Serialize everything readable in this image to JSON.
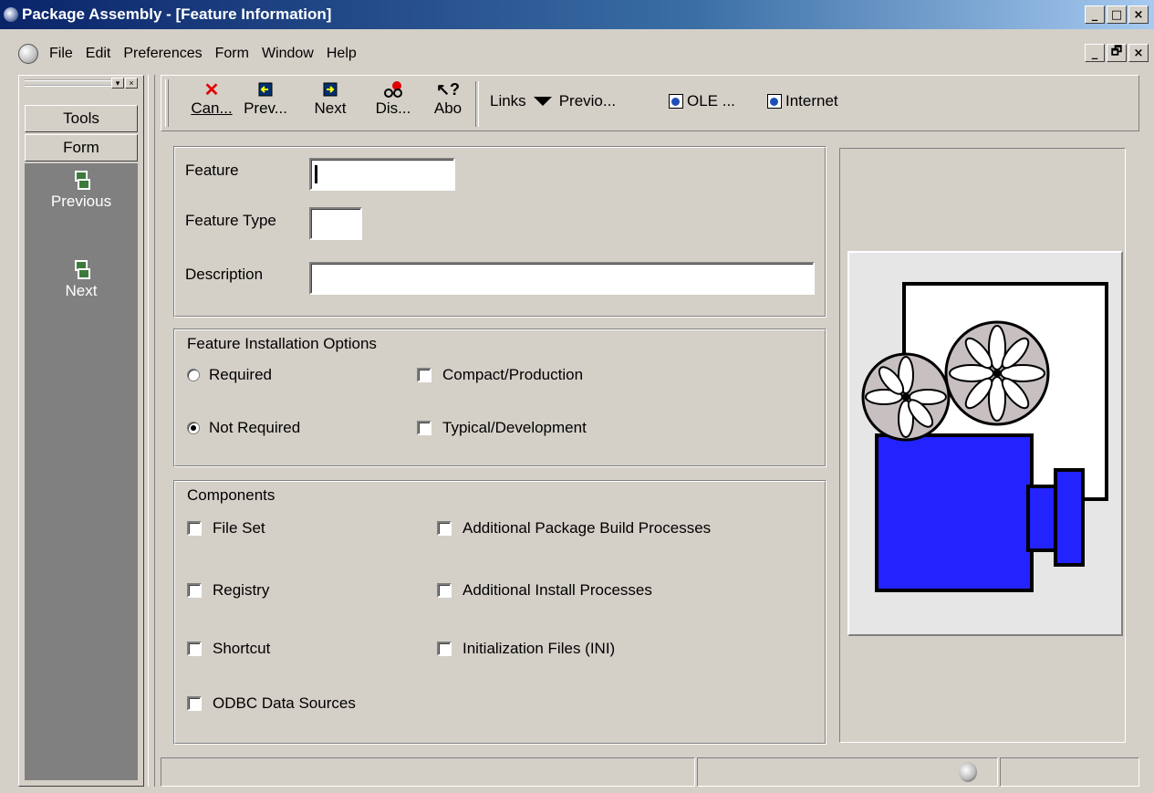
{
  "window": {
    "title": "Package Assembly - [Feature Information]",
    "buttons": [
      "_",
      "□",
      "×"
    ],
    "mdi_buttons": [
      "_",
      "🗗",
      "×"
    ]
  },
  "menu": {
    "items": [
      "File",
      "Edit",
      "Preferences",
      "Form",
      "Window",
      "Help"
    ]
  },
  "left_panel": {
    "sections": [
      "Tools",
      "Form"
    ],
    "nav_items": [
      {
        "label": "Previous",
        "icon": "previous-icon"
      },
      {
        "label": "Next",
        "icon": "next-icon"
      }
    ]
  },
  "toolbar": {
    "buttons": [
      {
        "label": "Can...",
        "icon": "cancel-x-icon"
      },
      {
        "label": "Prev...",
        "icon": "previous-record-icon"
      },
      {
        "label": "Next",
        "icon": "next-record-icon"
      },
      {
        "label": "Dis...",
        "icon": "display-glasses-icon"
      },
      {
        "label": "Abo",
        "icon": "about-help-icon"
      }
    ],
    "links_label": "Links",
    "links": [
      {
        "label": "Previo...",
        "icon": "dropdown-triangle-icon"
      },
      {
        "label": "OLE ...",
        "icon": "ole-document-icon"
      },
      {
        "label": "Internet",
        "icon": "internet-document-icon"
      }
    ]
  },
  "form": {
    "feature_label": "Feature",
    "feature_value": "",
    "feature_type_label": "Feature Type",
    "feature_type_value": "",
    "description_label": "Description",
    "description_value": "",
    "install_options": {
      "title": "Feature Installation Options",
      "radios": [
        {
          "label": "Required",
          "selected": false
        },
        {
          "label": "Not Required",
          "selected": true
        }
      ],
      "checkboxes": [
        {
          "label": "Compact/Production",
          "checked": false
        },
        {
          "label": "Typical/Development",
          "checked": false
        }
      ]
    },
    "components": {
      "title": "Components",
      "left": [
        {
          "label": "File Set",
          "checked": false
        },
        {
          "label": "Registry",
          "checked": false
        },
        {
          "label": "Shortcut",
          "checked": false
        },
        {
          "label": "ODBC Data Sources",
          "checked": false
        }
      ],
      "right": [
        {
          "label": "Additional Package Build Processes",
          "checked": false
        },
        {
          "label": "Additional Install Processes",
          "checked": false
        },
        {
          "label": "Initialization Files (INI)",
          "checked": false
        }
      ]
    }
  },
  "image": {
    "icon": "film-projector-icon"
  },
  "colors": {
    "title_start": "#0a246a",
    "title_end": "#a6caf0",
    "window_bg": "#d4d0c8",
    "nav_bg": "#808080",
    "projector_body": "#2323ff",
    "reel_fill": "#c8c0c0"
  }
}
